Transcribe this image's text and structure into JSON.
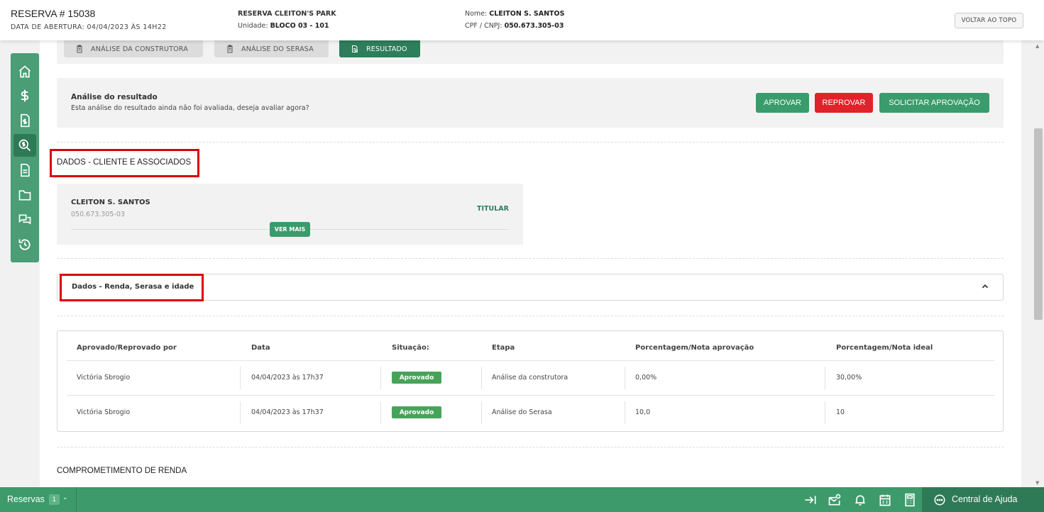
{
  "header": {
    "reserve_title": "RESERVA # 15038",
    "open_date": "DATA DE ABERTURA: 04/04/2023 ÀS 14H22",
    "project_name": "RESERVA CLEITON'S PARK",
    "unit_label": "Unidade: ",
    "unit_value": "BLOCO 03 - 101",
    "client_label": "Nome: ",
    "client_value": "CLEITON S. SANTOS",
    "cpf_label": "CPF / CNPJ: ",
    "cpf_value": "050.673.305-03",
    "back_to_top": "VOLTAR AO TOPO"
  },
  "sidebar": {
    "items": [
      {
        "icon": "home-icon"
      },
      {
        "icon": "dollar-icon"
      },
      {
        "icon": "invoice-icon"
      },
      {
        "icon": "search-money-icon",
        "active": true
      },
      {
        "icon": "document-icon"
      },
      {
        "icon": "folder-icon"
      },
      {
        "icon": "chat-icon"
      },
      {
        "icon": "history-icon"
      }
    ]
  },
  "tabs": [
    {
      "label": "ANÁLISE DA CONSTRUTORA",
      "active": false
    },
    {
      "label": "ANÁLISE DO SERASA",
      "active": false
    },
    {
      "label": "RESULTADO",
      "active": true
    }
  ],
  "analysis": {
    "title": "Análise do resultado",
    "description": "Esta análise do resultado ainda não foi avaliada, deseja avaliar agora?",
    "approve_label": "APROVAR",
    "reject_label": "REPROVAR",
    "request_label": "SOLICITAR APROVAÇÃO"
  },
  "clients_section": {
    "title": "DADOS - CLIENTE E ASSOCIADOS",
    "client": {
      "name": "CLEITON S. SANTOS",
      "cpf": "050.673.305-03",
      "role": "TITULAR",
      "more_label": "VER MAIS"
    }
  },
  "accordion": {
    "title": "Dados - Renda, Serasa e idade"
  },
  "table": {
    "headers": [
      "Aprovado/Reprovado por",
      "Data",
      "Situação:",
      "Etapa",
      "Porcentagem/Nota aprovação",
      "Porcentagem/Nota ideal"
    ],
    "rows": [
      [
        "Victória Sbrogio",
        "04/04/2023 às 17h37",
        "Aprovado",
        "Análise da construtora",
        "0,00%",
        "30,00%"
      ],
      [
        "Victória Sbrogio",
        "04/04/2023 às 17h37",
        "Aprovado",
        "Análise do Serasa",
        "10,0",
        "10"
      ]
    ]
  },
  "income_section": {
    "title": "COMPROMETIMENTO DE RENDA"
  },
  "bottombar": {
    "reservas_label": "Reservas",
    "reservas_count": "1",
    "help_label": "Central de Ajuda"
  },
  "colors": {
    "brand_green": "#3a9b6c",
    "dark_green": "#2e7d5b",
    "reject_red": "#e0232a",
    "highlight_red": "#d9000d"
  }
}
